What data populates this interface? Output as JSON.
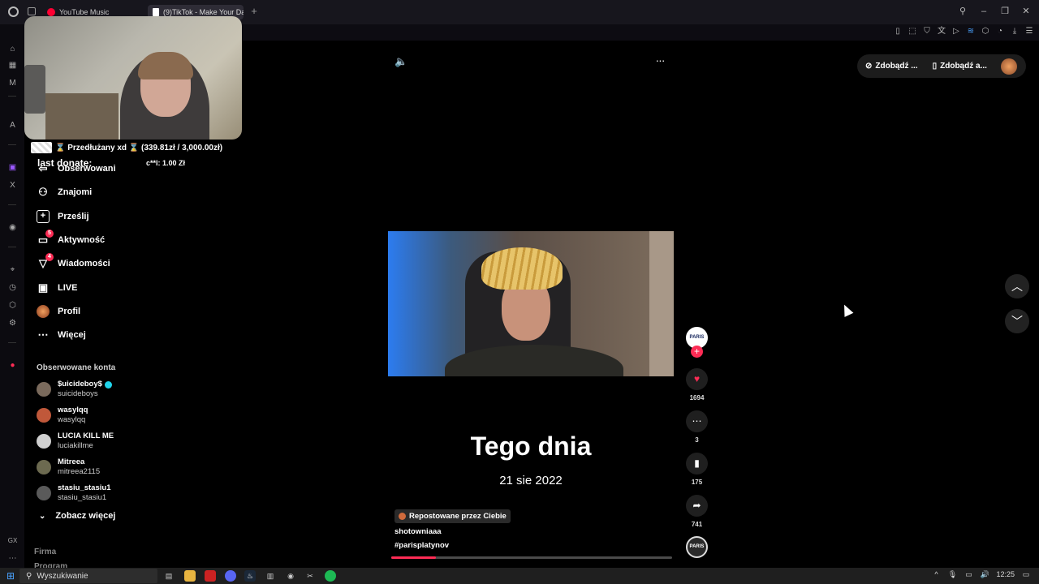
{
  "browser": {
    "tabs": [
      {
        "title": "YouTube Music",
        "active": false,
        "favicon_color": "#ff0033"
      },
      {
        "title": "(9)TikTok - Make Your Da",
        "active": true,
        "favicon_color": "#ffffff"
      }
    ],
    "new_tab_icon": "+"
  },
  "overlay": {
    "donation_text": "⌛ Przedłużany xd ⌛ (339.81zł / 3,000.00zł)",
    "last_donate_label": "last donate:",
    "last_donate_value": "c**l: 1.00 Zł"
  },
  "sidebar": {
    "nav": [
      {
        "label": "Obserwowani",
        "icon": "following-icon",
        "badge": ""
      },
      {
        "label": "Znajomi",
        "icon": "friends-icon",
        "badge": ""
      },
      {
        "label": "Prześlij",
        "icon": "upload-icon",
        "badge": ""
      },
      {
        "label": "Aktywność",
        "icon": "activity-icon",
        "badge": "5"
      },
      {
        "label": "Wiadomości",
        "icon": "messages-icon",
        "badge": "4"
      },
      {
        "label": "LIVE",
        "icon": "live-icon",
        "badge": ""
      },
      {
        "label": "Profil",
        "icon": "profile-avatar",
        "badge": ""
      },
      {
        "label": "Więcej",
        "icon": "more-icon",
        "badge": ""
      }
    ],
    "followed_title": "Obserwowane konta",
    "accounts": [
      {
        "name": "$uicideboy$",
        "user": "suicideboys",
        "verified": true,
        "color": "#7a6a5c"
      },
      {
        "name": "wasylqq",
        "user": "wasylqq",
        "verified": false,
        "color": "#c0583a"
      },
      {
        "name": "LUCIA KILL ME",
        "user": "luciakillme",
        "verified": false,
        "color": "#cfcfcf"
      },
      {
        "name": "Mitreea",
        "user": "mitreea2115",
        "verified": false,
        "color": "#6c6a50"
      },
      {
        "name": "stasiu_stasiu1",
        "user": "stasiu_stasiu1",
        "verified": false,
        "color": "#5a5a5a"
      }
    ],
    "see_more": "Zobacz więcej",
    "footer": [
      "Firma",
      "Program"
    ]
  },
  "video": {
    "title": "Tego dnia",
    "date": "21 sie 2022",
    "repost_label": "Repostowane przez Ciebie",
    "author": "shotowniaaa",
    "hashtag": "#parisplatynov",
    "progress": 0.16
  },
  "actions": {
    "creator_avatar_text": "PARIS",
    "likes": "1694",
    "comments": "3",
    "saves": "175",
    "shares": "741",
    "disc_text": "PARIS"
  },
  "top_right": {
    "get_items": [
      "Zdobądź ...",
      "Zdobądź a..."
    ]
  },
  "taskbar": {
    "search_placeholder": "Wyszukiwanie",
    "time": "12:25"
  },
  "colors": {
    "accent": "#fe2c55",
    "background": "#000000"
  }
}
